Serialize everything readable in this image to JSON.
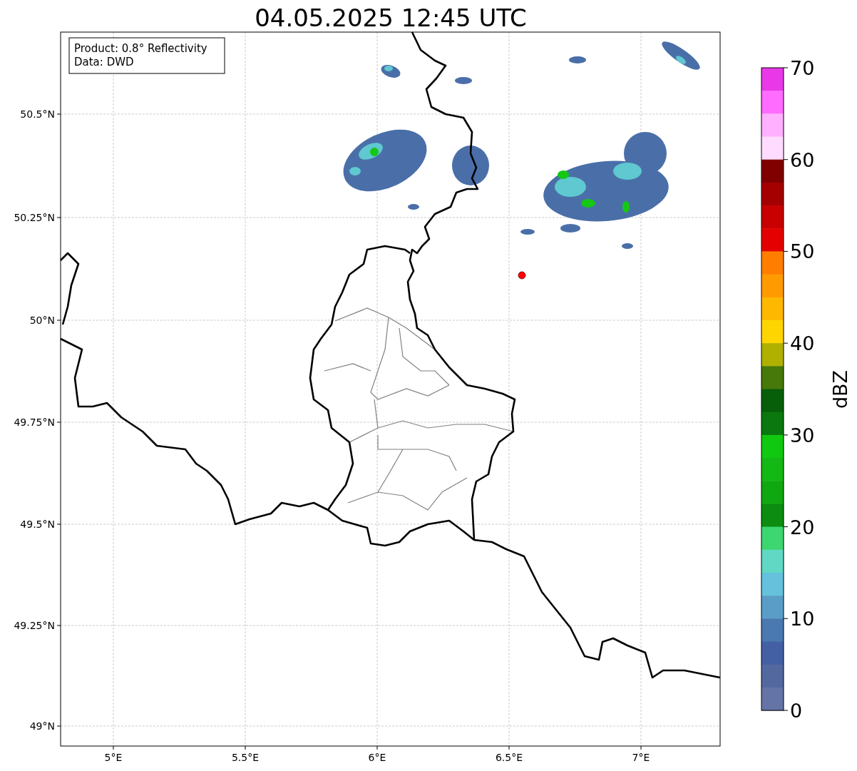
{
  "title": "04.05.2025 12:45 UTC",
  "map": {
    "info_box": [
      "Product: 0.8° Reflectivity",
      "Data: DWD"
    ],
    "lat_ticks": [
      "50.5°N",
      "50.25°N",
      "50°N",
      "49.75°N",
      "49.5°N",
      "49.25°N",
      "49°N"
    ],
    "lon_ticks": [
      "5°E",
      "5.5°E",
      "6°E",
      "6.5°E",
      "7°E"
    ]
  },
  "colorbar": {
    "label": "dBZ",
    "ticks": [
      "70",
      "60",
      "50",
      "40",
      "30",
      "20",
      "10",
      "0"
    ],
    "bins": [
      {
        "color": "#e838e8"
      },
      {
        "color": "#ff6cff"
      },
      {
        "color": "#ffb0ff"
      },
      {
        "color": "#ffdcff"
      },
      {
        "color": "#800000"
      },
      {
        "color": "#a40000"
      },
      {
        "color": "#c80000"
      },
      {
        "color": "#e40000"
      },
      {
        "color": "#ff7e00"
      },
      {
        "color": "#ff9a00"
      },
      {
        "color": "#ffb800"
      },
      {
        "color": "#ffd500"
      },
      {
        "color": "#b0b000"
      },
      {
        "color": "#46780a"
      },
      {
        "color": "#085f0a"
      },
      {
        "color": "#0a780e"
      },
      {
        "color": "#10c810"
      },
      {
        "color": "#14b814"
      },
      {
        "color": "#10a810"
      },
      {
        "color": "#0c8c10"
      },
      {
        "color": "#3ed670"
      },
      {
        "color": "#60d8c4"
      },
      {
        "color": "#66c2dc"
      },
      {
        "color": "#5a9ec8"
      },
      {
        "color": "#4a78b0"
      },
      {
        "color": "#4360a5"
      },
      {
        "color": "#5468a0"
      },
      {
        "color": "#6474a6"
      }
    ]
  }
}
